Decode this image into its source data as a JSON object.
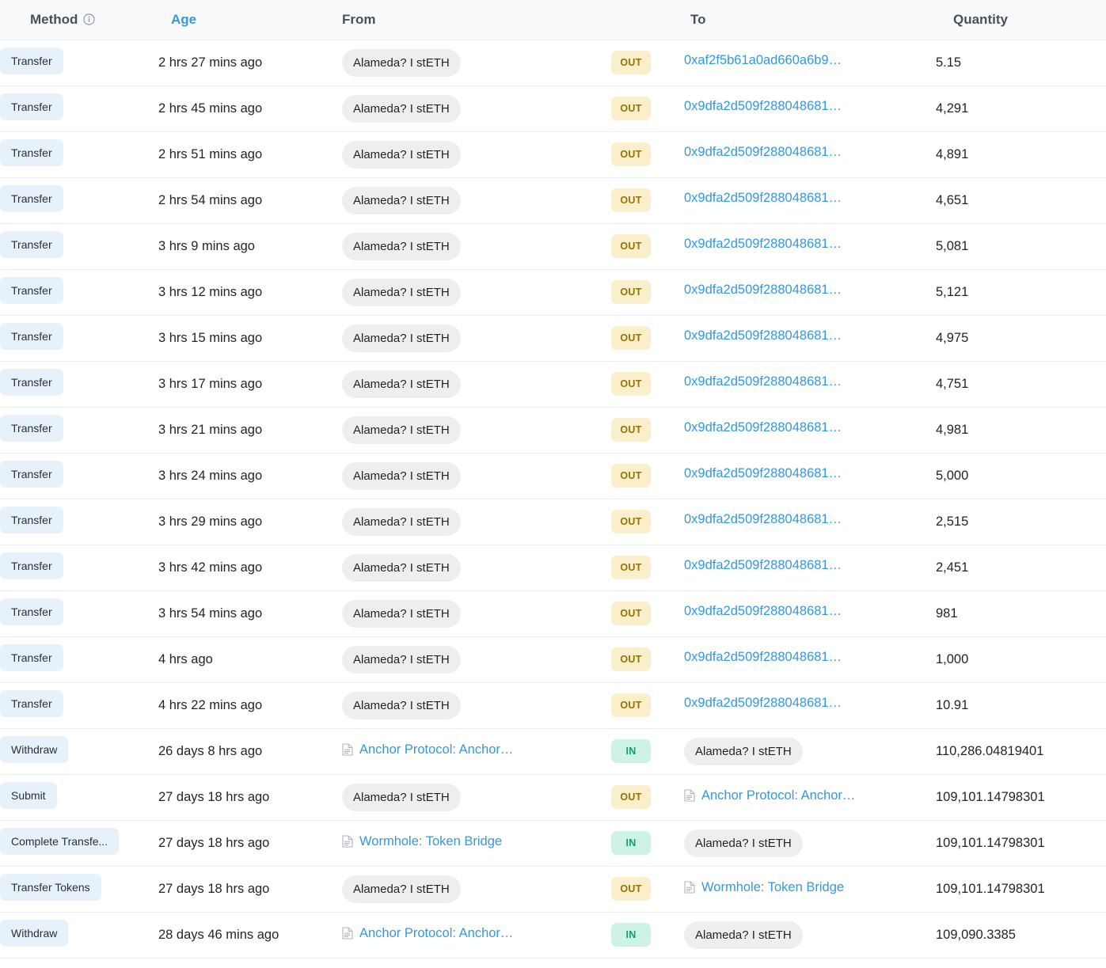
{
  "table": {
    "columns": [
      {
        "key": "method",
        "label": "Method",
        "has_info_icon": true,
        "accent": false
      },
      {
        "key": "age",
        "label": "Age",
        "has_info_icon": false,
        "accent": true
      },
      {
        "key": "from",
        "label": "From",
        "has_info_icon": false,
        "accent": false
      },
      {
        "key": "dir",
        "label": "",
        "has_info_icon": false,
        "accent": false
      },
      {
        "key": "to",
        "label": "To",
        "has_info_icon": false,
        "accent": false
      },
      {
        "key": "quantity",
        "label": "Quantity",
        "has_info_icon": false,
        "accent": false
      }
    ],
    "rows": [
      {
        "method": "Transfer",
        "age": "2 hrs 27 mins ago",
        "from": "Alameda? I stETH",
        "from_type": "pill",
        "direction": "OUT",
        "to": "0xaf2f5b61a0ad660a6b9…",
        "to_type": "link",
        "quantity": "5.15"
      },
      {
        "method": "Transfer",
        "age": "2 hrs 45 mins ago",
        "from": "Alameda? I stETH",
        "from_type": "pill",
        "direction": "OUT",
        "to": "0x9dfa2d509f288048681…",
        "to_type": "link",
        "quantity": "4,291"
      },
      {
        "method": "Transfer",
        "age": "2 hrs 51 mins ago",
        "from": "Alameda? I stETH",
        "from_type": "pill",
        "direction": "OUT",
        "to": "0x9dfa2d509f288048681…",
        "to_type": "link",
        "quantity": "4,891"
      },
      {
        "method": "Transfer",
        "age": "2 hrs 54 mins ago",
        "from": "Alameda? I stETH",
        "from_type": "pill",
        "direction": "OUT",
        "to": "0x9dfa2d509f288048681…",
        "to_type": "link",
        "quantity": "4,651"
      },
      {
        "method": "Transfer",
        "age": "3 hrs 9 mins ago",
        "from": "Alameda? I stETH",
        "from_type": "pill",
        "direction": "OUT",
        "to": "0x9dfa2d509f288048681…",
        "to_type": "link",
        "quantity": "5,081"
      },
      {
        "method": "Transfer",
        "age": "3 hrs 12 mins ago",
        "from": "Alameda? I stETH",
        "from_type": "pill",
        "direction": "OUT",
        "to": "0x9dfa2d509f288048681…",
        "to_type": "link",
        "quantity": "5,121"
      },
      {
        "method": "Transfer",
        "age": "3 hrs 15 mins ago",
        "from": "Alameda? I stETH",
        "from_type": "pill",
        "direction": "OUT",
        "to": "0x9dfa2d509f288048681…",
        "to_type": "link",
        "quantity": "4,975"
      },
      {
        "method": "Transfer",
        "age": "3 hrs 17 mins ago",
        "from": "Alameda? I stETH",
        "from_type": "pill",
        "direction": "OUT",
        "to": "0x9dfa2d509f288048681…",
        "to_type": "link",
        "quantity": "4,751"
      },
      {
        "method": "Transfer",
        "age": "3 hrs 21 mins ago",
        "from": "Alameda? I stETH",
        "from_type": "pill",
        "direction": "OUT",
        "to": "0x9dfa2d509f288048681…",
        "to_type": "link",
        "quantity": "4,981"
      },
      {
        "method": "Transfer",
        "age": "3 hrs 24 mins ago",
        "from": "Alameda? I stETH",
        "from_type": "pill",
        "direction": "OUT",
        "to": "0x9dfa2d509f288048681…",
        "to_type": "link",
        "quantity": "5,000"
      },
      {
        "method": "Transfer",
        "age": "3 hrs 29 mins ago",
        "from": "Alameda? I stETH",
        "from_type": "pill",
        "direction": "OUT",
        "to": "0x9dfa2d509f288048681…",
        "to_type": "link",
        "quantity": "2,515"
      },
      {
        "method": "Transfer",
        "age": "3 hrs 42 mins ago",
        "from": "Alameda? I stETH",
        "from_type": "pill",
        "direction": "OUT",
        "to": "0x9dfa2d509f288048681…",
        "to_type": "link",
        "quantity": "2,451"
      },
      {
        "method": "Transfer",
        "age": "3 hrs 54 mins ago",
        "from": "Alameda? I stETH",
        "from_type": "pill",
        "direction": "OUT",
        "to": "0x9dfa2d509f288048681…",
        "to_type": "link",
        "quantity": "981"
      },
      {
        "method": "Transfer",
        "age": "4 hrs ago",
        "from": "Alameda? I stETH",
        "from_type": "pill",
        "direction": "OUT",
        "to": "0x9dfa2d509f288048681…",
        "to_type": "link",
        "quantity": "1,000"
      },
      {
        "method": "Transfer",
        "age": "4 hrs 22 mins ago",
        "from": "Alameda? I stETH",
        "from_type": "pill",
        "direction": "OUT",
        "to": "0x9dfa2d509f288048681…",
        "to_type": "link",
        "quantity": "10.91"
      },
      {
        "method": "Withdraw",
        "age": "26 days 8 hrs ago",
        "from": "Anchor Protocol: Anchor…",
        "from_type": "contract",
        "direction": "IN",
        "to": "Alameda? I stETH",
        "to_type": "pill",
        "quantity": "110,286.04819401"
      },
      {
        "method": "Submit",
        "age": "27 days 18 hrs ago",
        "from": "Alameda? I stETH",
        "from_type": "pill",
        "direction": "OUT",
        "to": "Anchor Protocol: Anchor…",
        "to_type": "contract",
        "quantity": "109,101.14798301"
      },
      {
        "method": "Complete Transfe...",
        "age": "27 days 18 hrs ago",
        "from": "Wormhole: Token Bridge",
        "from_type": "contract",
        "direction": "IN",
        "to": "Alameda? I stETH",
        "to_type": "pill",
        "quantity": "109,101.14798301"
      },
      {
        "method": "Transfer Tokens",
        "age": "27 days 18 hrs ago",
        "from": "Alameda? I stETH",
        "from_type": "pill",
        "direction": "OUT",
        "to": "Wormhole: Token Bridge",
        "to_type": "contract",
        "quantity": "109,101.14798301"
      },
      {
        "method": "Withdraw",
        "age": "28 days 46 mins ago",
        "from": "Anchor Protocol: Anchor…",
        "from_type": "contract",
        "direction": "IN",
        "to": "Alameda? I stETH",
        "to_type": "pill",
        "quantity": "109,090.3385"
      }
    ]
  },
  "icons": {
    "info": "info-icon",
    "contract": "document-icon"
  },
  "colors": {
    "link": "#3498db",
    "accent_header": "#3498db",
    "method_chip_bg": "#e7f1fa",
    "pill_bg": "#eceef0",
    "badge_out_bg": "#fbeeca",
    "badge_out_text": "#937206",
    "badge_in_bg": "#cdf3e4",
    "badge_in_text": "#0f9d73",
    "header_bg": "#f8f9fb",
    "row_divider": "#eceff2"
  }
}
